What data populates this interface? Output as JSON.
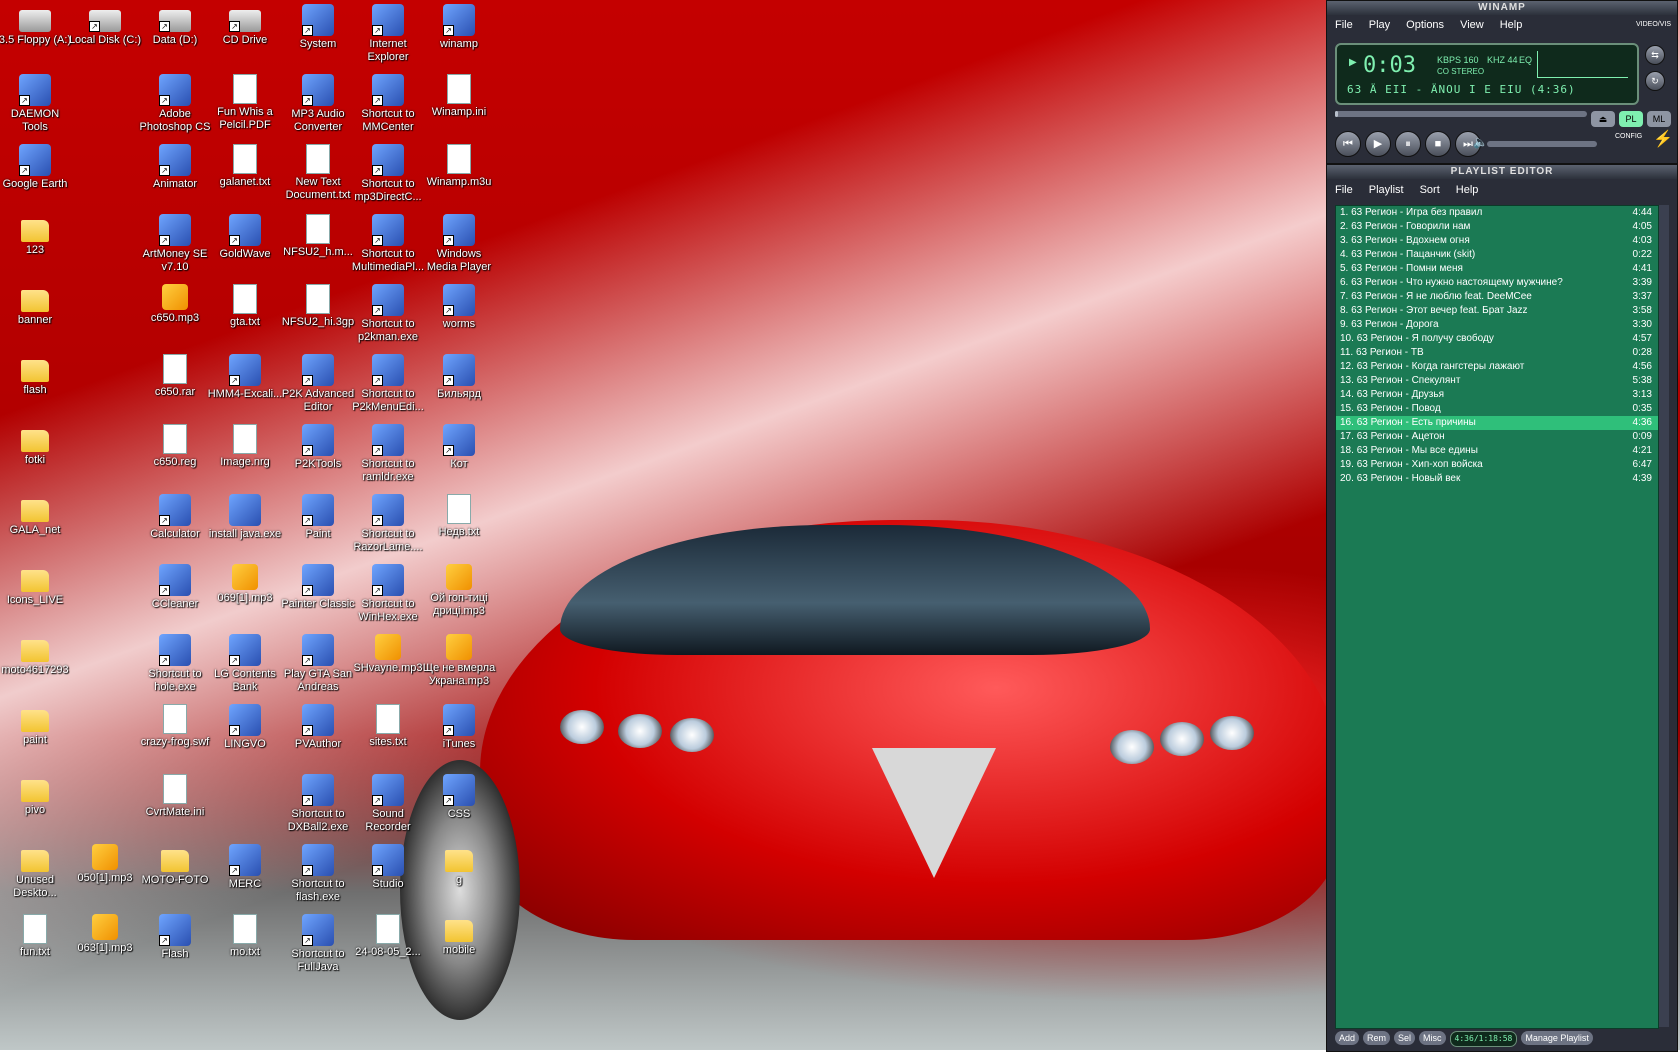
{
  "desktop": {
    "icons": [
      {
        "label": "3.5 Floppy (A:)",
        "col": 0,
        "row": 0,
        "kind": "drive",
        "icon": "floppy-icon",
        "shortcut": false
      },
      {
        "label": "Local Disk (C:)",
        "col": 1,
        "row": 0,
        "kind": "drive",
        "icon": "disk-icon",
        "shortcut": true
      },
      {
        "label": "Data (D:)",
        "col": 2,
        "row": 0,
        "kind": "drive",
        "icon": "disk-icon",
        "shortcut": true
      },
      {
        "label": "CD Drive",
        "col": 3,
        "row": 0,
        "kind": "drive",
        "icon": "cd-icon",
        "shortcut": true
      },
      {
        "label": "System",
        "col": 4,
        "row": 0,
        "kind": "app",
        "icon": "system-icon",
        "shortcut": true
      },
      {
        "label": "Internet Explorer",
        "col": 5,
        "row": 0,
        "kind": "app",
        "icon": "ie-icon",
        "shortcut": true
      },
      {
        "label": "winamp",
        "col": 6,
        "row": 0,
        "kind": "app",
        "icon": "winamp-icon",
        "shortcut": true
      },
      {
        "label": "DAEMON Tools",
        "col": 0,
        "row": 1,
        "kind": "app",
        "icon": "daemon-icon",
        "shortcut": true
      },
      {
        "label": "Adobe Photoshop CS",
        "col": 2,
        "row": 1,
        "kind": "app",
        "icon": "photoshop-icon",
        "shortcut": true
      },
      {
        "label": "Fun Whis a Pelcil.PDF",
        "col": 3,
        "row": 1,
        "kind": "doc",
        "icon": "pdf-icon",
        "shortcut": false
      },
      {
        "label": "MP3 Audio Converter",
        "col": 4,
        "row": 1,
        "kind": "app",
        "icon": "converter-icon",
        "shortcut": true
      },
      {
        "label": "Shortcut to MMCenter",
        "col": 5,
        "row": 1,
        "kind": "app",
        "icon": "mmcenter-icon",
        "shortcut": true
      },
      {
        "label": "Winamp.ini",
        "col": 6,
        "row": 1,
        "kind": "doc",
        "icon": "ini-icon",
        "shortcut": false
      },
      {
        "label": "Google Earth",
        "col": 0,
        "row": 2,
        "kind": "app",
        "icon": "globe-icon",
        "shortcut": true
      },
      {
        "label": "Animator",
        "col": 2,
        "row": 2,
        "kind": "app",
        "icon": "film-icon",
        "shortcut": true
      },
      {
        "label": "galanet.txt",
        "col": 3,
        "row": 2,
        "kind": "doc",
        "icon": "txt-icon",
        "shortcut": false
      },
      {
        "label": "New Text Document.txt",
        "col": 4,
        "row": 2,
        "kind": "doc",
        "icon": "txt-icon",
        "shortcut": false
      },
      {
        "label": "Shortcut to mp3DirectC...",
        "col": 5,
        "row": 2,
        "kind": "app",
        "icon": "mp3cut-icon",
        "shortcut": true
      },
      {
        "label": "Winamp.m3u",
        "col": 6,
        "row": 2,
        "kind": "doc",
        "icon": "playlist-file-icon",
        "shortcut": false
      },
      {
        "label": "123",
        "col": 0,
        "row": 3,
        "kind": "folder",
        "icon": "folder-icon",
        "shortcut": false
      },
      {
        "label": "ArtMoney SE v7.10",
        "col": 2,
        "row": 3,
        "kind": "app",
        "icon": "money-icon",
        "shortcut": true
      },
      {
        "label": "GoldWave",
        "col": 3,
        "row": 3,
        "kind": "app",
        "icon": "wave-icon",
        "shortcut": true
      },
      {
        "label": "NFSU2_h.m...",
        "col": 4,
        "row": 3,
        "kind": "doc",
        "icon": "video-file-icon",
        "shortcut": false
      },
      {
        "label": "Shortcut to MultimediaPl...",
        "col": 5,
        "row": 3,
        "kind": "app",
        "icon": "media-icon",
        "shortcut": true
      },
      {
        "label": "Windows Media Player",
        "col": 6,
        "row": 3,
        "kind": "app",
        "icon": "wmp-icon",
        "shortcut": true
      },
      {
        "label": "banner",
        "col": 0,
        "row": 4,
        "kind": "folder",
        "icon": "folder-icon",
        "shortcut": false
      },
      {
        "label": "c650.mp3",
        "col": 2,
        "row": 4,
        "kind": "mp3",
        "icon": "mp3-icon",
        "shortcut": false
      },
      {
        "label": "gta.txt",
        "col": 3,
        "row": 4,
        "kind": "doc",
        "icon": "txt-icon",
        "shortcut": false
      },
      {
        "label": "NFSU2_hi.3gp",
        "col": 4,
        "row": 4,
        "kind": "doc",
        "icon": "video-file-icon",
        "shortcut": false
      },
      {
        "label": "Shortcut to p2kman.exe",
        "col": 5,
        "row": 4,
        "kind": "app",
        "icon": "phone-icon",
        "shortcut": true
      },
      {
        "label": "worms",
        "col": 6,
        "row": 4,
        "kind": "app",
        "icon": "radiation-icon",
        "shortcut": true
      },
      {
        "label": "flash",
        "col": 0,
        "row": 5,
        "kind": "folder",
        "icon": "folder-icon",
        "shortcut": false
      },
      {
        "label": "c650.rar",
        "col": 2,
        "row": 5,
        "kind": "doc",
        "icon": "archive-icon",
        "shortcut": false
      },
      {
        "label": "HMM4-Excali...",
        "col": 3,
        "row": 5,
        "kind": "app",
        "icon": "game-icon",
        "shortcut": true
      },
      {
        "label": "P2K Advanced Editor",
        "col": 4,
        "row": 5,
        "kind": "app",
        "icon": "phone-icon",
        "shortcut": true
      },
      {
        "label": "Shortcut to P2kMenuEdi...",
        "col": 5,
        "row": 5,
        "kind": "app",
        "icon": "menu-editor-icon",
        "shortcut": true
      },
      {
        "label": "Бильярд",
        "col": 6,
        "row": 5,
        "kind": "app",
        "icon": "billiard-icon",
        "shortcut": true
      },
      {
        "label": "fotki",
        "col": 0,
        "row": 6,
        "kind": "folder",
        "icon": "folder-icon",
        "shortcut": false
      },
      {
        "label": "c650.reg",
        "col": 2,
        "row": 6,
        "kind": "doc",
        "icon": "registry-icon",
        "shortcut": false
      },
      {
        "label": "Image.nrg",
        "col": 3,
        "row": 6,
        "kind": "doc",
        "icon": "disc-image-icon",
        "shortcut": false
      },
      {
        "label": "P2KTools",
        "col": 4,
        "row": 6,
        "kind": "app",
        "icon": "phone-icon",
        "shortcut": true
      },
      {
        "label": "Shortcut to ramldr.exe",
        "col": 5,
        "row": 6,
        "kind": "app",
        "icon": "window-icon",
        "shortcut": true
      },
      {
        "label": "Кот",
        "col": 6,
        "row": 6,
        "kind": "app",
        "icon": "star-icon",
        "shortcut": true
      },
      {
        "label": "GALA_net",
        "col": 0,
        "row": 7,
        "kind": "folder",
        "icon": "folder-icon",
        "shortcut": false
      },
      {
        "label": "Calculator",
        "col": 2,
        "row": 7,
        "kind": "app",
        "icon": "calculator-icon",
        "shortcut": true
      },
      {
        "label": "install java.exe",
        "col": 3,
        "row": 7,
        "kind": "app",
        "icon": "install-icon",
        "shortcut": false
      },
      {
        "label": "Paint",
        "col": 4,
        "row": 7,
        "kind": "app",
        "icon": "paint-icon",
        "shortcut": true
      },
      {
        "label": "Shortcut to RazorLame....",
        "col": 5,
        "row": 7,
        "kind": "app",
        "icon": "razor-icon",
        "shortcut": true
      },
      {
        "label": "Недв.txt",
        "col": 6,
        "row": 7,
        "kind": "doc",
        "icon": "txt-icon",
        "shortcut": false
      },
      {
        "label": "Icons_LIVE",
        "col": 0,
        "row": 8,
        "kind": "folder",
        "icon": "folder-icon",
        "shortcut": false
      },
      {
        "label": "CCleaner",
        "col": 2,
        "row": 8,
        "kind": "app",
        "icon": "ccleaner-icon",
        "shortcut": true
      },
      {
        "label": "069[1].mp3",
        "col": 3,
        "row": 8,
        "kind": "mp3",
        "icon": "mp3-icon",
        "shortcut": false
      },
      {
        "label": "Painter Classic",
        "col": 4,
        "row": 8,
        "kind": "app",
        "icon": "painter-icon",
        "shortcut": true
      },
      {
        "label": "Shortcut to WinHex.exe",
        "col": 5,
        "row": 8,
        "kind": "app",
        "icon": "hex-icon",
        "shortcut": true
      },
      {
        "label": "Ой гоп-тиці дриці.mp3",
        "col": 6,
        "row": 8,
        "kind": "mp3",
        "icon": "mp3-icon",
        "shortcut": false
      },
      {
        "label": "moto4617293",
        "col": 0,
        "row": 9,
        "kind": "folder",
        "icon": "folder-icon",
        "shortcut": false
      },
      {
        "label": "Shortcut to hole.exe",
        "col": 2,
        "row": 9,
        "kind": "app",
        "icon": "hole-icon",
        "shortcut": true
      },
      {
        "label": "LG Contents Bank",
        "col": 3,
        "row": 9,
        "kind": "app",
        "icon": "lg-icon",
        "shortcut": true
      },
      {
        "label": "Play GTA San Andreas",
        "col": 4,
        "row": 9,
        "kind": "app",
        "icon": "gta-icon",
        "shortcut": true
      },
      {
        "label": "SHvayne.mp3",
        "col": 5,
        "row": 9,
        "kind": "mp3",
        "icon": "mp3-icon",
        "shortcut": false
      },
      {
        "label": "Ще не вмерла Украна.mp3",
        "col": 6,
        "row": 9,
        "kind": "mp3",
        "icon": "mp3-icon",
        "shortcut": false
      },
      {
        "label": "paint",
        "col": 0,
        "row": 10,
        "kind": "folder",
        "icon": "folder-icon",
        "shortcut": false
      },
      {
        "label": "crazy-frog.swf",
        "col": 2,
        "row": 10,
        "kind": "doc",
        "icon": "swf-icon",
        "shortcut": false
      },
      {
        "label": "LINGVO",
        "col": 3,
        "row": 10,
        "kind": "app",
        "icon": "lingvo-icon",
        "shortcut": true
      },
      {
        "label": "PVAuthor",
        "col": 4,
        "row": 10,
        "kind": "app",
        "icon": "pvauthor-icon",
        "shortcut": true
      },
      {
        "label": "sites.txt",
        "col": 5,
        "row": 10,
        "kind": "doc",
        "icon": "txt-icon",
        "shortcut": false
      },
      {
        "label": "iTunes",
        "col": 6,
        "row": 10,
        "kind": "app",
        "icon": "itunes-icon",
        "shortcut": true
      },
      {
        "label": "pivo",
        "col": 0,
        "row": 11,
        "kind": "folder",
        "icon": "folder-icon",
        "shortcut": false
      },
      {
        "label": "CvrtMate.ini",
        "col": 2,
        "row": 11,
        "kind": "doc",
        "icon": "ini-icon",
        "shortcut": false
      },
      {
        "label": "Shortcut to DXBall2.exe",
        "col": 4,
        "row": 11,
        "kind": "app",
        "icon": "ball-icon",
        "shortcut": true
      },
      {
        "label": "Sound Recorder",
        "col": 5,
        "row": 11,
        "kind": "app",
        "icon": "recorder-icon",
        "shortcut": true
      },
      {
        "label": "CSS",
        "col": 6,
        "row": 11,
        "kind": "app",
        "icon": "halflife-icon",
        "shortcut": true
      },
      {
        "label": "Unused Deskto...",
        "col": 0,
        "row": 12,
        "kind": "folder",
        "icon": "folder-icon",
        "shortcut": false
      },
      {
        "label": "050[1].mp3",
        "col": 1,
        "row": 12,
        "kind": "mp3",
        "icon": "mp3-icon",
        "shortcut": false
      },
      {
        "label": "MOTO-FOTO",
        "col": 2,
        "row": 12,
        "kind": "folder",
        "icon": "folder-icon",
        "shortcut": false
      },
      {
        "label": "MERC",
        "col": 3,
        "row": 12,
        "kind": "app",
        "icon": "merc-icon",
        "shortcut": true
      },
      {
        "label": "Shortcut to flash.exe",
        "col": 4,
        "row": 12,
        "kind": "app",
        "icon": "window-icon",
        "shortcut": true
      },
      {
        "label": "Studio",
        "col": 5,
        "row": 12,
        "kind": "app",
        "icon": "studio-icon",
        "shortcut": true
      },
      {
        "label": "g",
        "col": 6,
        "row": 12,
        "kind": "folder",
        "icon": "folder-icon",
        "shortcut": false
      },
      {
        "label": "fun.txt",
        "col": 0,
        "row": 13,
        "kind": "doc",
        "icon": "txt-icon",
        "shortcut": false
      },
      {
        "label": "063[1].mp3",
        "col": 1,
        "row": 13,
        "kind": "mp3",
        "icon": "mp3-icon",
        "shortcut": false
      },
      {
        "label": "Flash",
        "col": 2,
        "row": 13,
        "kind": "app",
        "icon": "flash-icon",
        "shortcut": true
      },
      {
        "label": "mo.txt",
        "col": 3,
        "row": 13,
        "kind": "doc",
        "icon": "txt-icon",
        "shortcut": false
      },
      {
        "label": "Shortcut to FullJava",
        "col": 4,
        "row": 13,
        "kind": "app",
        "icon": "java-icon",
        "shortcut": true
      },
      {
        "label": "24-08-05_2...",
        "col": 5,
        "row": 13,
        "kind": "doc",
        "icon": "jpg-icon",
        "shortcut": false
      },
      {
        "label": "mobile",
        "col": 6,
        "row": 13,
        "kind": "folder",
        "icon": "folder-icon",
        "shortcut": false
      }
    ]
  },
  "winamp": {
    "title": "WINAMP",
    "menu": [
      "File",
      "Play",
      "Options",
      "View",
      "Help"
    ],
    "time": "0:03",
    "kbps": "KBPS 160",
    "khz": "KHZ 44",
    "stereo": "CO STEREO",
    "eq_label": "EQ",
    "scroll_text": "63 Ä EII - ÄNOU I E EIU (4:36)",
    "video_vis_label": "VIDEO/VIS",
    "pl_button": "PL",
    "ml_button": "ML",
    "config_label": "CONFIG",
    "play_progress": 0.01
  },
  "playlist": {
    "title": "PLAYLIST EDITOR",
    "menu": [
      "File",
      "Playlist",
      "Sort",
      "Help"
    ],
    "selected_index": 15,
    "tracks": [
      {
        "n": "1.",
        "title": "63 Регион - Игра без правил",
        "dur": "4:44"
      },
      {
        "n": "2.",
        "title": "63 Регион - Говорили нам",
        "dur": "4:05"
      },
      {
        "n": "3.",
        "title": "63 Регион - Вдохнем огня",
        "dur": "4:03"
      },
      {
        "n": "4.",
        "title": "63 Регион - Пацанчик (skit)",
        "dur": "0:22"
      },
      {
        "n": "5.",
        "title": "63 Регион - Помни меня",
        "dur": "4:41"
      },
      {
        "n": "6.",
        "title": "63 Регион - Что нужно настоящему мужчине?",
        "dur": "3:39"
      },
      {
        "n": "7.",
        "title": "63 Регион - Я не люблю feat. DeeMCee",
        "dur": "3:37"
      },
      {
        "n": "8.",
        "title": "63 Регион - Этот вечер feat. Брат Jazz",
        "dur": "3:58"
      },
      {
        "n": "9.",
        "title": "63 Регион - Дорога",
        "dur": "3:30"
      },
      {
        "n": "10.",
        "title": "63 Регион - Я получу свободу",
        "dur": "4:57"
      },
      {
        "n": "11.",
        "title": "63 Регион - ТВ",
        "dur": "0:28"
      },
      {
        "n": "12.",
        "title": "63 Регион - Когда гангстеры лажают",
        "dur": "4:56"
      },
      {
        "n": "13.",
        "title": "63 Регион - Спекулянт",
        "dur": "5:38"
      },
      {
        "n": "14.",
        "title": "63 Регион - Друзья",
        "dur": "3:13"
      },
      {
        "n": "15.",
        "title": "63 Регион - Повод",
        "dur": "0:35"
      },
      {
        "n": "16.",
        "title": "63 Регион - Есть причины",
        "dur": "4:36"
      },
      {
        "n": "17.",
        "title": "63 Регион - Ацетон",
        "dur": "0:09"
      },
      {
        "n": "18.",
        "title": "63 Регион - Мы все едины",
        "dur": "4:21"
      },
      {
        "n": "19.",
        "title": "63 Регион - Хип-хоп войска",
        "dur": "6:47"
      },
      {
        "n": "20.",
        "title": "63 Регион - Новый век",
        "dur": "4:39"
      }
    ],
    "buttons": {
      "add": "Add",
      "rem": "Rem",
      "sel": "Sel",
      "misc": "Misc",
      "manage": "Manage Playlist"
    },
    "status": "4:36/1:18:58"
  }
}
